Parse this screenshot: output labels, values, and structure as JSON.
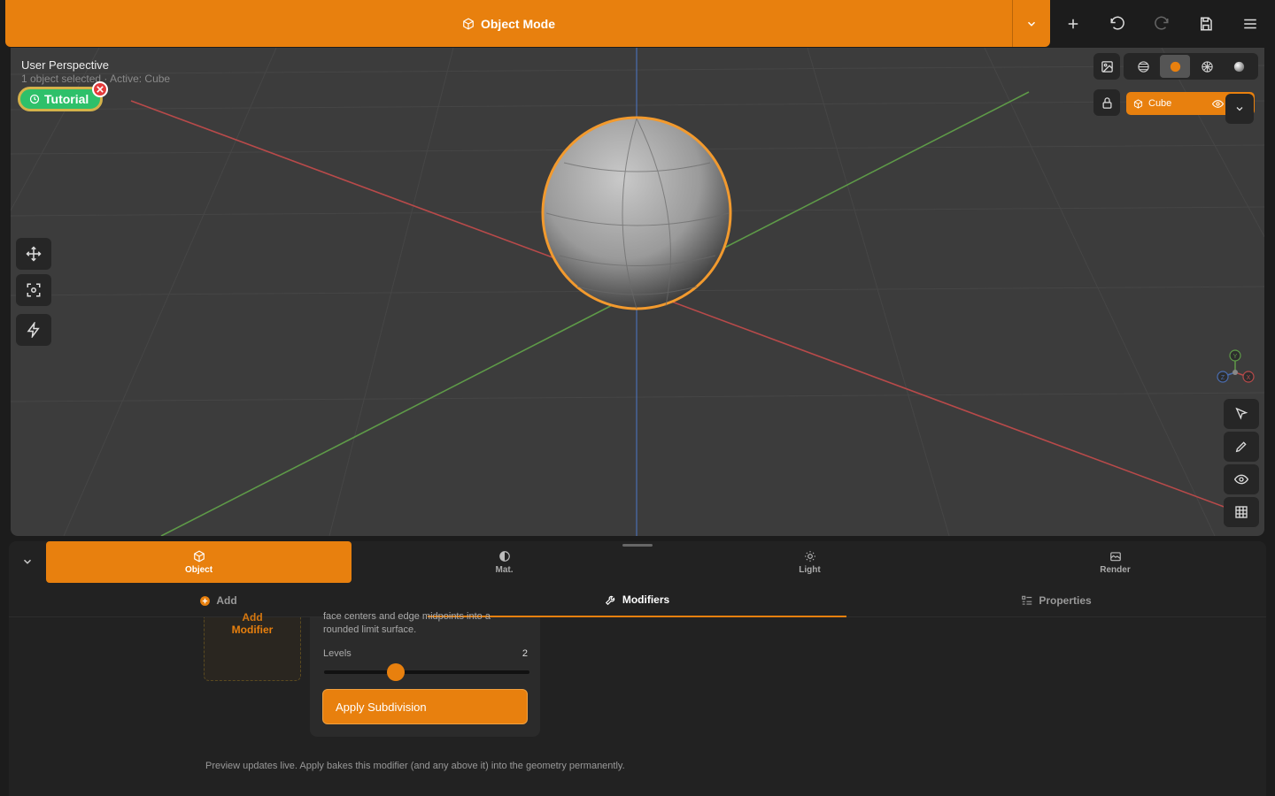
{
  "header": {
    "mode_label": "Object Mode"
  },
  "viewport": {
    "title": "User Perspective",
    "subtitle": "1 object selected · Active: Cube",
    "tutorial_label": "Tutorial",
    "active_object": "Cube",
    "gizmo": {
      "y": "Y",
      "x": "X",
      "z": "Z"
    }
  },
  "panel": {
    "tabs": [
      {
        "label": "Object"
      },
      {
        "label": "Mat."
      },
      {
        "label": "Light"
      },
      {
        "label": "Render"
      }
    ],
    "subtabs": [
      {
        "label": "Add"
      },
      {
        "label": "Modifiers"
      },
      {
        "label": "Properties"
      }
    ],
    "add_modifier": {
      "line1": "Add",
      "line2": "Modifier"
    },
    "modifier": {
      "desc_line1": "face centers and edge midpoints into a",
      "desc_line2": "rounded limit surface.",
      "levels_label": "Levels",
      "levels_value": "2",
      "levels_fraction": 0.35,
      "apply_label": "Apply Subdivision"
    },
    "footnote": "Preview updates live. Apply bakes this modifier (and any above it) into the geometry permanently."
  },
  "colors": {
    "accent": "#e8800e",
    "success": "#2ec06a",
    "danger": "#e43b3b"
  }
}
